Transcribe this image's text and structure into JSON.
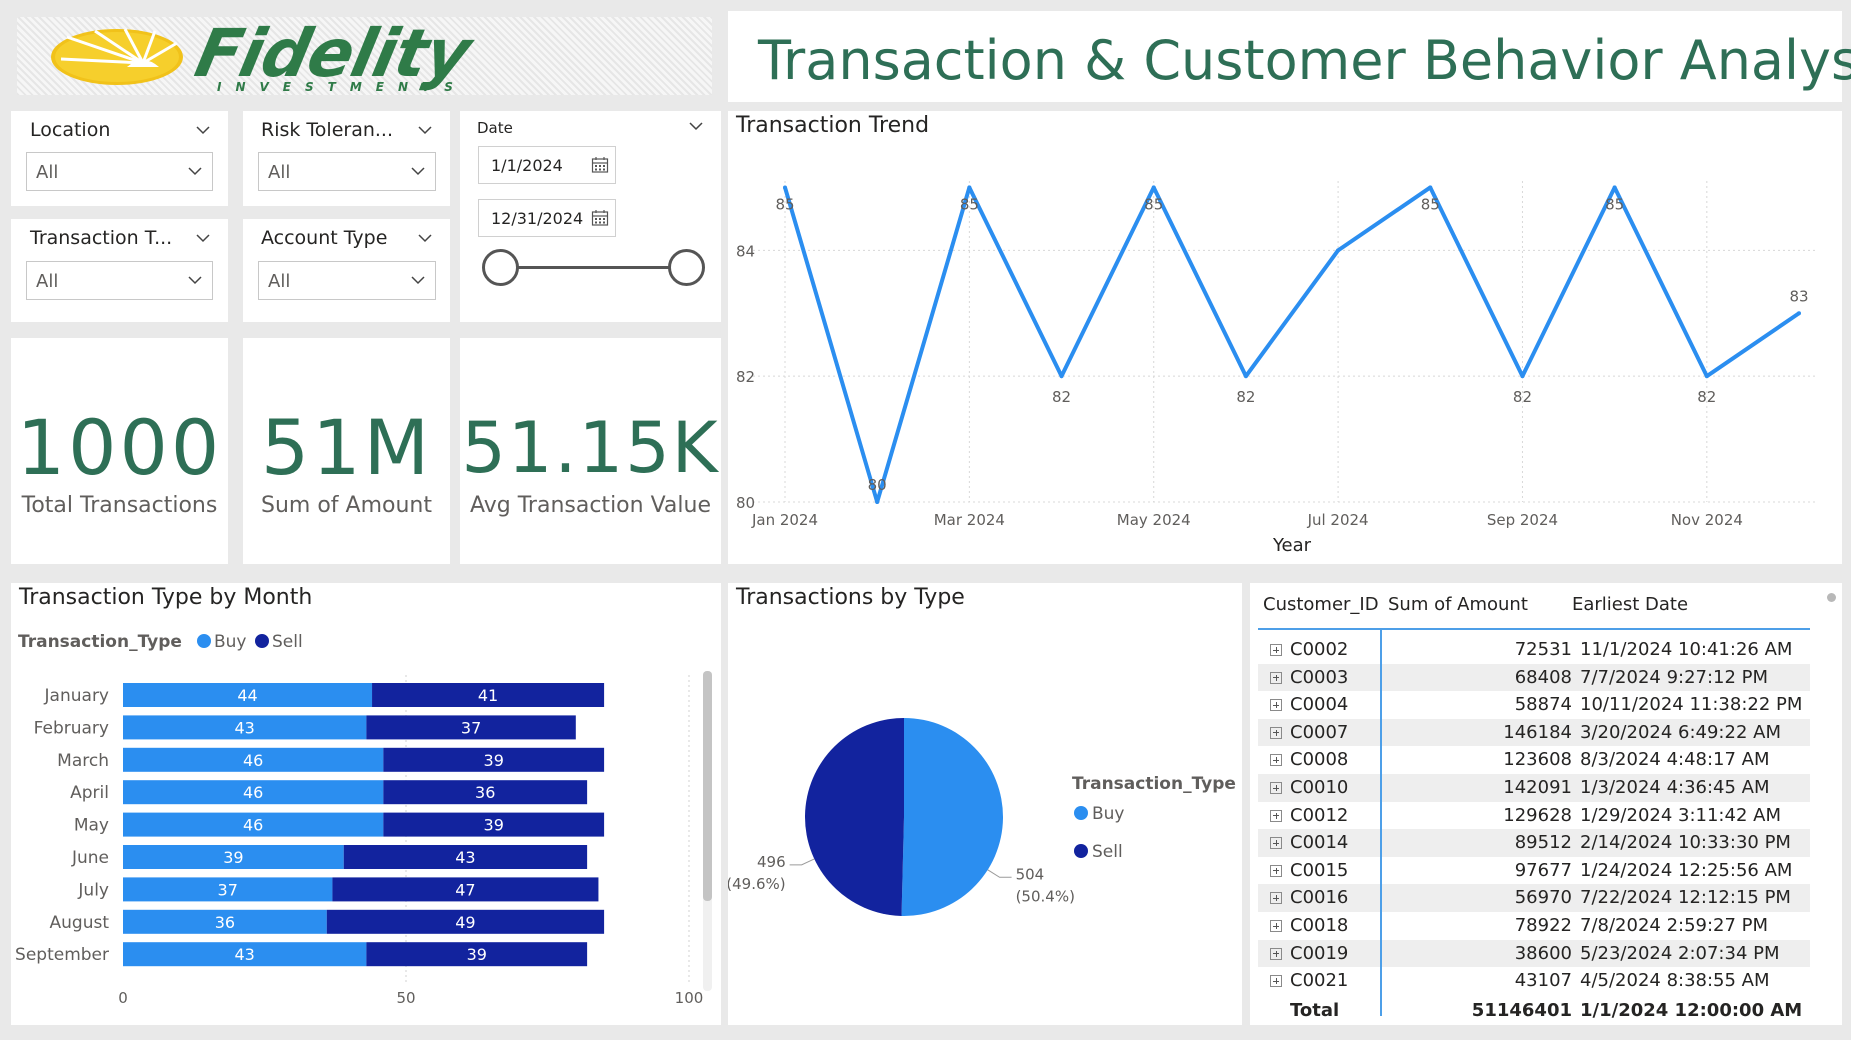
{
  "logo": {
    "name": "Fidelity",
    "sub": "INVESTMENTS"
  },
  "header": {
    "title": "Transaction & Customer Behavior Analysis"
  },
  "slicers": {
    "location": {
      "label": "Location",
      "value": "All"
    },
    "risk": {
      "label": "Risk Toleran...",
      "value": "All"
    },
    "transaction_type": {
      "label": "Transaction T...",
      "value": "All"
    },
    "account_type": {
      "label": "Account Type",
      "value": "All"
    },
    "date": {
      "label": "Date",
      "start": "1/1/2024",
      "end": "12/31/2024"
    }
  },
  "kpis": {
    "total": {
      "value": "1000",
      "label": "Total Transactions"
    },
    "sum": {
      "value": "51M",
      "label": "Sum of Amount"
    },
    "avg": {
      "value": "51.15K",
      "label": "Avg Transaction Value"
    }
  },
  "trend": {
    "title": "Transaction Trend",
    "chart_data": {
      "type": "line",
      "x": [
        "Jan 2024",
        "Feb 2024",
        "Mar 2024",
        "Apr 2024",
        "May 2024",
        "Jun 2024",
        "Jul 2024",
        "Aug 2024",
        "Sep 2024",
        "Oct 2024",
        "Nov 2024",
        "Dec 2024"
      ],
      "x_tick_labels": [
        "Jan 2024",
        "Mar 2024",
        "May 2024",
        "Jul 2024",
        "Sep 2024",
        "Nov 2024"
      ],
      "values": [
        85,
        80,
        85,
        82,
        85,
        82,
        84,
        85,
        82,
        85,
        82,
        83
      ],
      "data_labels": [
        "85",
        "80",
        "85",
        "82",
        "85",
        "82",
        "",
        "85",
        "82",
        "85",
        "82",
        "83"
      ],
      "ylim": [
        80,
        85.5
      ],
      "yticks": [
        80,
        82,
        84
      ],
      "xlabel": "Year",
      "color": "#2b8ef0",
      "grid": true
    }
  },
  "month_bar": {
    "title": "Transaction Type by Month",
    "chart_data": {
      "type": "bar",
      "stacked": true,
      "orientation": "horizontal",
      "legend_title": "Transaction_Type",
      "categories": [
        "January",
        "February",
        "March",
        "April",
        "May",
        "June",
        "July",
        "August",
        "September"
      ],
      "series": [
        {
          "name": "Buy",
          "color": "#2b8ef0",
          "values": [
            44,
            43,
            46,
            46,
            46,
            39,
            37,
            36,
            43
          ]
        },
        {
          "name": "Sell",
          "color": "#12239e",
          "values": [
            41,
            37,
            39,
            36,
            39,
            43,
            47,
            49,
            39
          ]
        }
      ],
      "xticks": [
        0,
        50,
        100
      ],
      "xlim": [
        0,
        100
      ],
      "legend_position": "top-left"
    }
  },
  "pie": {
    "title": "Transactions by Type",
    "chart_data": {
      "type": "pie",
      "legend_title": "Transaction_Type",
      "slices": [
        {
          "name": "Buy",
          "value": 504,
          "pct": "(50.4%)",
          "color": "#2b8ef0"
        },
        {
          "name": "Sell",
          "value": 496,
          "pct": "(49.6%)",
          "color": "#12239e"
        }
      ],
      "legend_position": "right"
    }
  },
  "table": {
    "columns": [
      "Customer_ID",
      "Sum of Amount",
      "Earliest Date"
    ],
    "rows": [
      [
        "C0002",
        "72531",
        "11/1/2024 10:41:26 AM"
      ],
      [
        "C0003",
        "68408",
        "7/7/2024 9:27:12 PM"
      ],
      [
        "C0004",
        "58874",
        "10/11/2024 11:38:22 PM"
      ],
      [
        "C0007",
        "146184",
        "3/20/2024 6:49:22 AM"
      ],
      [
        "C0008",
        "123608",
        "8/3/2024 4:48:17 AM"
      ],
      [
        "C0010",
        "142091",
        "1/3/2024 4:36:45 AM"
      ],
      [
        "C0012",
        "129628",
        "1/29/2024 3:11:42 AM"
      ],
      [
        "C0014",
        "89512",
        "2/14/2024 10:33:30 PM"
      ],
      [
        "C0015",
        "97677",
        "1/24/2024 12:25:56 AM"
      ],
      [
        "C0016",
        "56970",
        "7/22/2024 12:12:15 PM"
      ],
      [
        "C0018",
        "78922",
        "7/8/2024 2:59:27 PM"
      ],
      [
        "C0019",
        "38600",
        "5/23/2024 2:07:34 PM"
      ],
      [
        "C0021",
        "43107",
        "4/5/2024 8:38:55 AM"
      ]
    ],
    "total": [
      "Total",
      "51146401",
      "1/1/2024 12:00:00 AM"
    ]
  },
  "colors": {
    "accent_green": "#2e6f56",
    "buy": "#2b8ef0",
    "sell": "#12239e"
  }
}
